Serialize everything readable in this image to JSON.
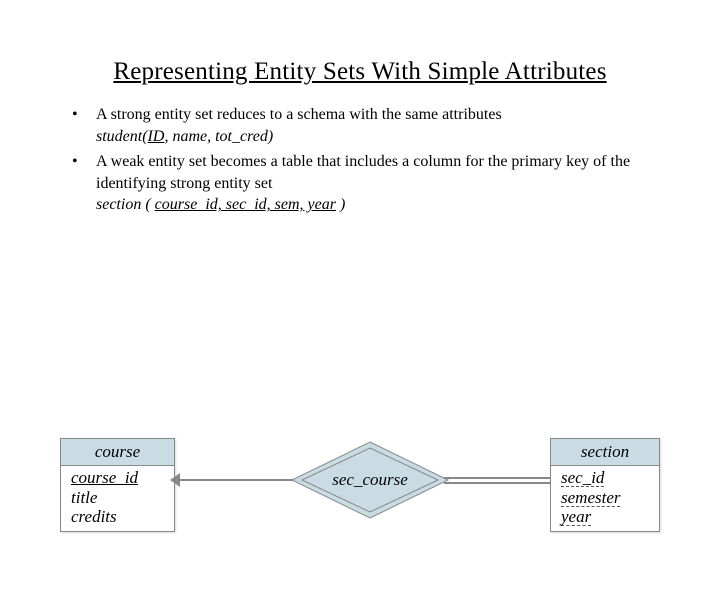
{
  "title": "Representing Entity Sets With Simple Attributes",
  "b1": {
    "line1": "A strong entity set reduces to a schema with the same attributes",
    "schema_name": "student(",
    "pk": "ID",
    "rest": ", name, tot_cred)"
  },
  "b2": {
    "line1": "A weak entity set becomes a table that includes a column for the primary key of the identifying strong entity set",
    "schema_name": "section ( ",
    "pk": "course_id, sec_id, sem, year",
    "rest": " )"
  },
  "diagram": {
    "left": {
      "name": "course",
      "a1": "course_id",
      "a2": "title",
      "a3": "credits"
    },
    "rel": "sec_course",
    "right": {
      "name": "section",
      "a1": "sec_id",
      "a2": "semester",
      "a3": "year"
    }
  }
}
